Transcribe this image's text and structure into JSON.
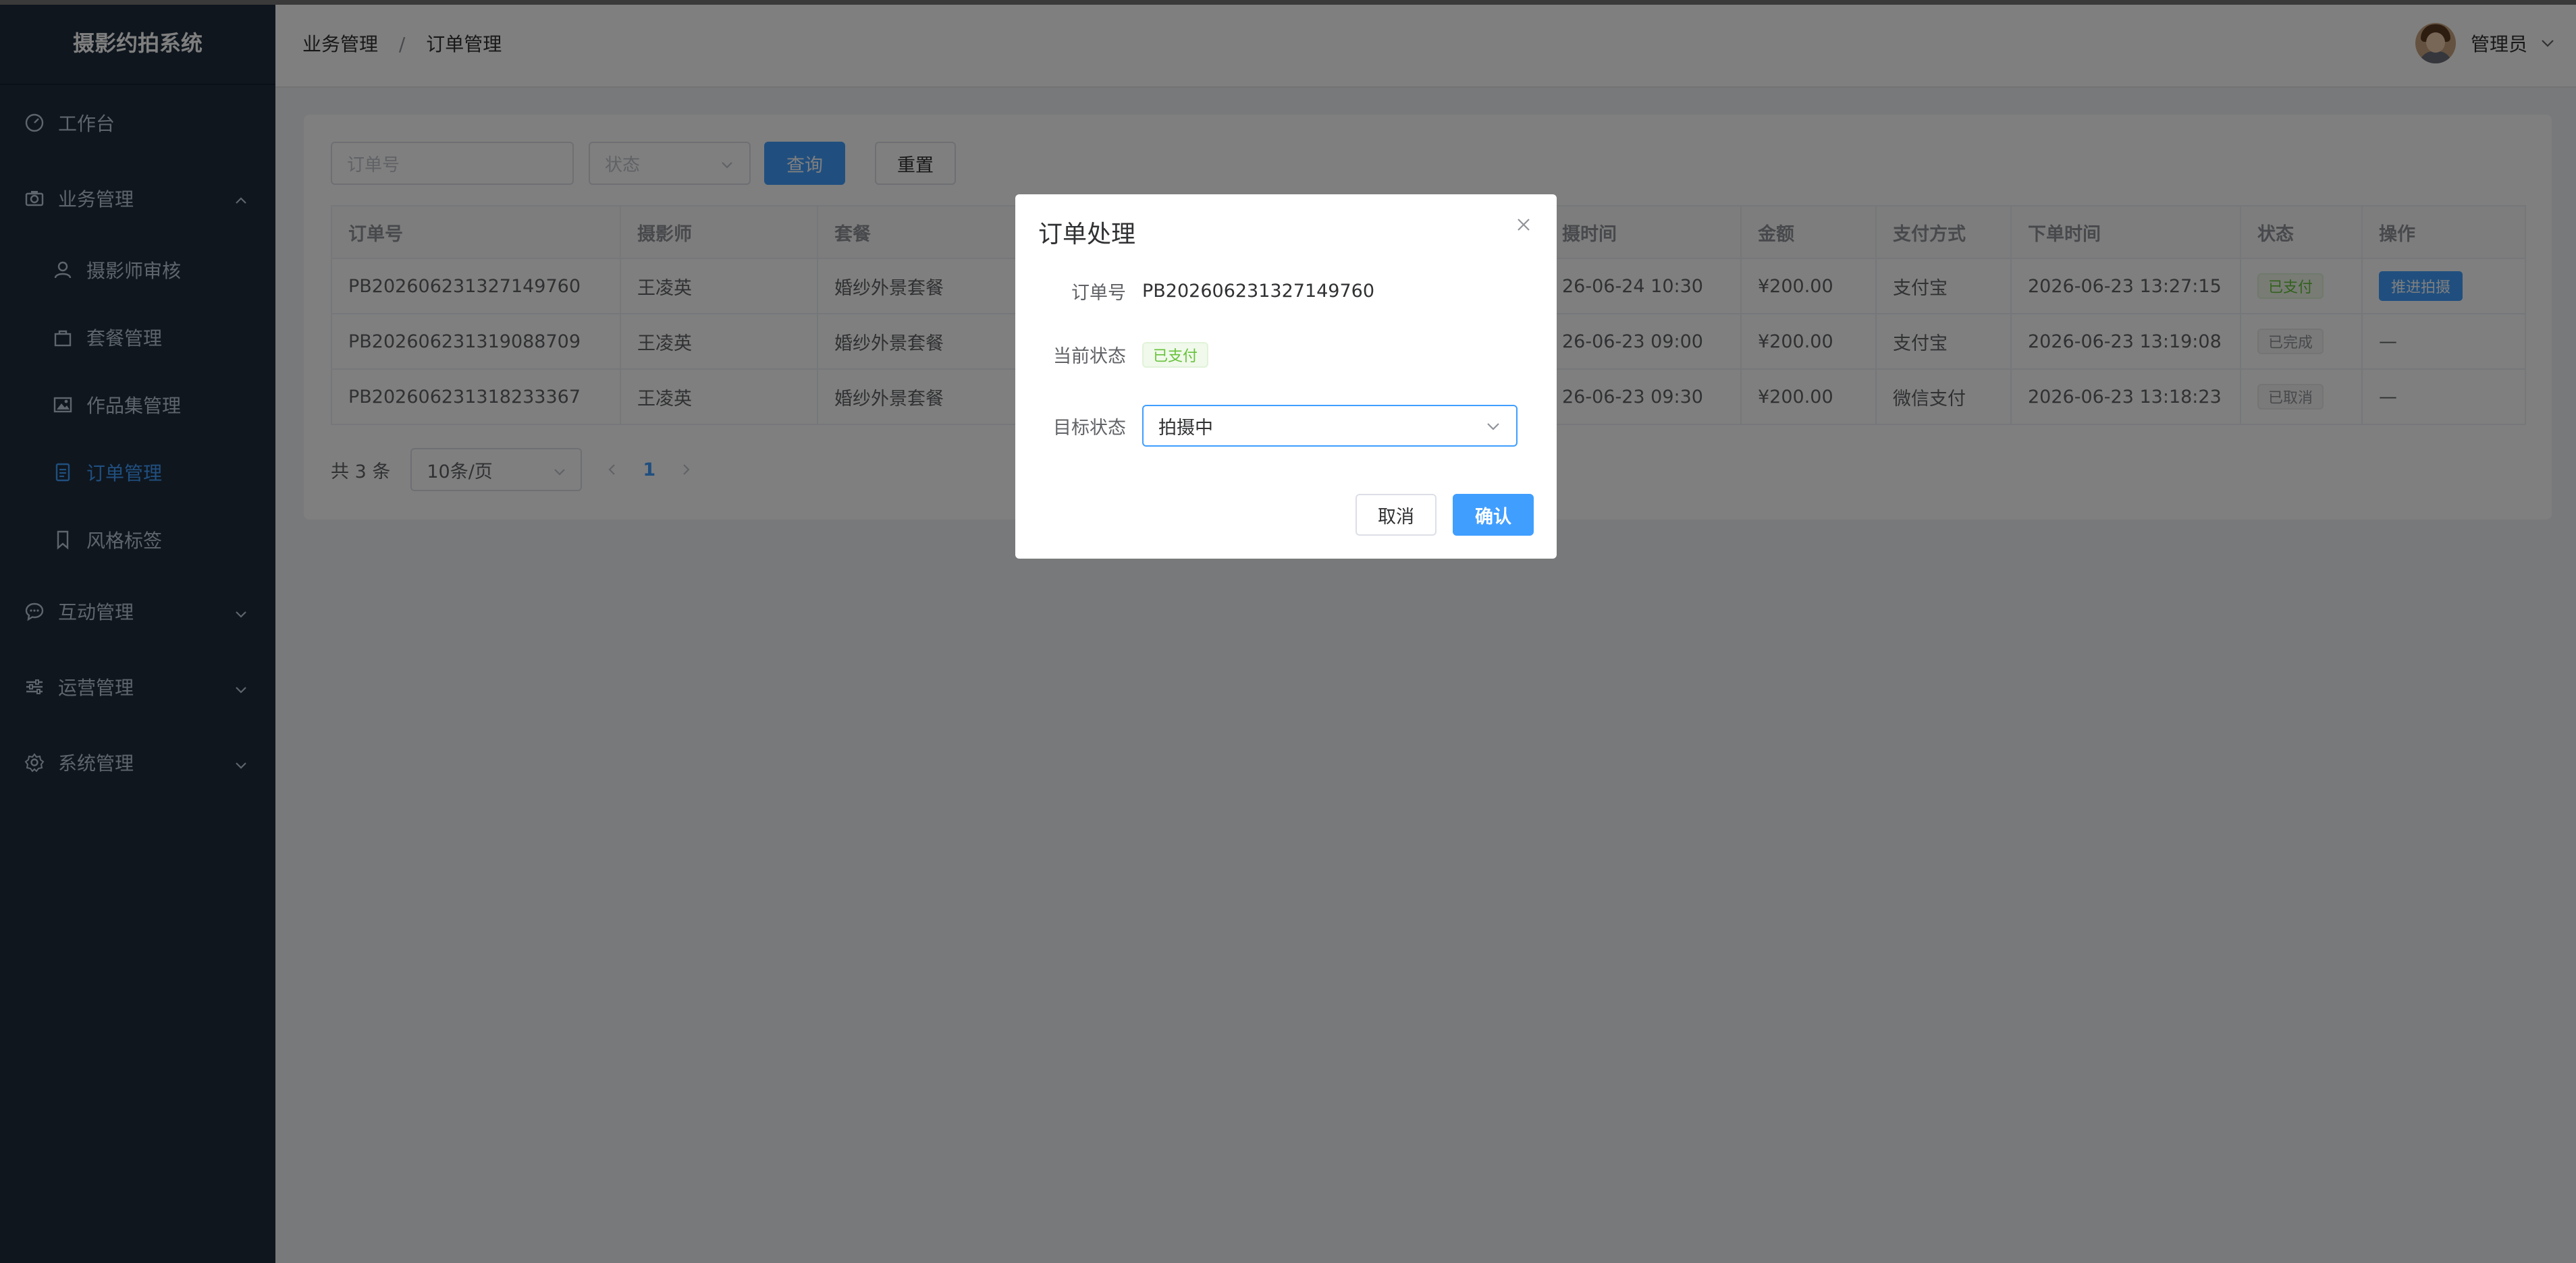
{
  "app": {
    "title": "摄影约拍系统"
  },
  "sidebar": {
    "items": [
      {
        "label": "工作台",
        "icon": "dashboard-icon"
      },
      {
        "label": "业务管理",
        "icon": "camera-icon",
        "expanded": true,
        "children": [
          {
            "label": "摄影师审核",
            "icon": "user-icon"
          },
          {
            "label": "套餐管理",
            "icon": "bag-icon"
          },
          {
            "label": "作品集管理",
            "icon": "picture-icon"
          },
          {
            "label": "订单管理",
            "icon": "document-icon",
            "active": true
          },
          {
            "label": "风格标签",
            "icon": "bookmark-icon"
          }
        ]
      },
      {
        "label": "互动管理",
        "icon": "chat-icon"
      },
      {
        "label": "运营管理",
        "icon": "sliders-icon"
      },
      {
        "label": "系统管理",
        "icon": "gear-icon"
      }
    ]
  },
  "header": {
    "breadcrumb": [
      "业务管理",
      "订单管理"
    ],
    "breadcrumb_sep": "/",
    "user_name": "管理员"
  },
  "filters": {
    "order_placeholder": "订单号",
    "status_placeholder": "状态",
    "query_label": "查询",
    "reset_label": "重置"
  },
  "table": {
    "columns": [
      "订单号",
      "摄影师",
      "套餐",
      "",
      "",
      "",
      "拍摄时间",
      "金额",
      "支付方式",
      "下单时间",
      "状态",
      "操作"
    ],
    "visible_columns": [
      "订单号",
      "摄影师",
      "套餐",
      "摄时间",
      "金额",
      "支付方式",
      "下单时间",
      "状态",
      "操作"
    ],
    "rows": [
      {
        "order_no": "PB202606231327149760",
        "photographer": "王凌英",
        "package": "婚纱外景套餐",
        "shoot_time": "26-06-24 10:30",
        "amount": "¥200.00",
        "pay_method": "支付宝",
        "order_time": "2026-06-23 13:27:15",
        "status": "已支付",
        "status_type": "success",
        "action": "推进拍摄"
      },
      {
        "order_no": "PB202606231319088709",
        "photographer": "王凌英",
        "package": "婚纱外景套餐",
        "shoot_time": "26-06-23 09:00",
        "amount": "¥200.00",
        "pay_method": "支付宝",
        "order_time": "2026-06-23 13:19:08",
        "status": "已完成",
        "status_type": "info",
        "action": "—"
      },
      {
        "order_no": "PB202606231318233367",
        "photographer": "王凌英",
        "package": "婚纱外景套餐",
        "shoot_time": "26-06-23 09:30",
        "amount": "¥200.00",
        "pay_method": "微信支付",
        "order_time": "2026-06-23 13:18:23",
        "status": "已取消",
        "status_type": "info",
        "action": "—"
      }
    ]
  },
  "pagination": {
    "total_text": "共 3 条",
    "page_size": "10条/页",
    "current_page": "1"
  },
  "dialog": {
    "title": "订单处理",
    "order_no_label": "订单号",
    "order_no_value": "PB202606231327149760",
    "current_status_label": "当前状态",
    "current_status_value": "已支付",
    "target_status_label": "目标状态",
    "target_status_value": "拍摄中",
    "cancel_label": "取消",
    "confirm_label": "确认"
  },
  "colors": {
    "primary": "#409eff",
    "sidebar_bg": "#1f2d3d",
    "success": "#67c23a"
  }
}
